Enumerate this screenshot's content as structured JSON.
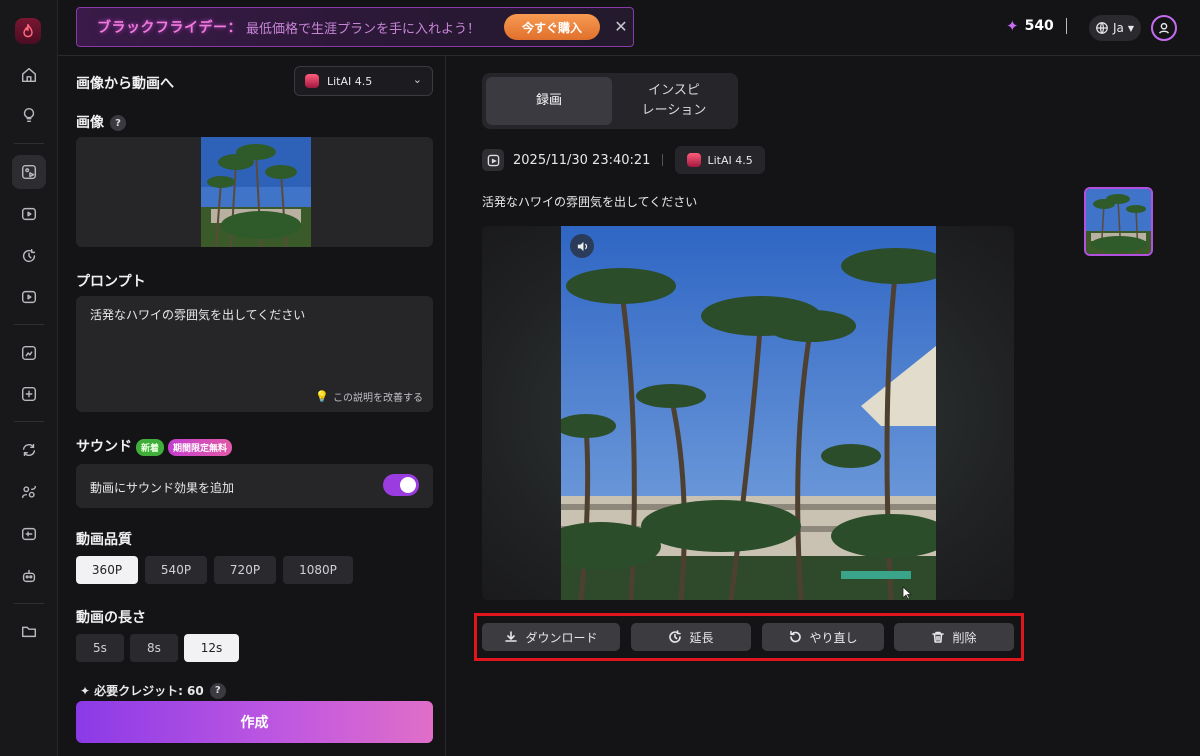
{
  "app": {
    "accent": "#9a3ce0",
    "logo": "flame-logo-icon"
  },
  "rail": {
    "icons": [
      "home-icon",
      "bulb-icon",
      "image-to-video-icon",
      "text-to-video-icon",
      "extend-icon",
      "video-icon",
      "image-edit-icon",
      "image-add-icon",
      "swap-icon",
      "people-icon",
      "lip-sync-icon",
      "robot-icon",
      "folder-icon"
    ]
  },
  "promo": {
    "title": "ブラックフライデー：",
    "message": "最低価格で生涯プランを手に入れよう！",
    "button": "今すぐ購入",
    "close": "✕"
  },
  "header": {
    "credits": "540",
    "language": "Ja"
  },
  "panel": {
    "title": "画像から動画へ",
    "model": "LitAI 4.5",
    "image_label": "画像",
    "help": "?",
    "prompt_label": "プロンプト",
    "prompt_text": "活発なハワイの雰囲気を出してください",
    "improve": "この説明を改善する",
    "sound_label": "サウンド",
    "badge_new": "新着",
    "badge_limited": "期間限定無料",
    "sound_option": "動画にサウンド効果を追加",
    "sound_enabled": true,
    "quality_label": "動画品質",
    "qualities": [
      "360P",
      "540P",
      "720P",
      "1080P"
    ],
    "quality_selected": "360P",
    "length_label": "動画の長さ",
    "lengths": [
      "5s",
      "8s",
      "12s"
    ],
    "length_selected": "12s",
    "credit_need": "必要クレジット: 60",
    "create": "作成"
  },
  "result": {
    "tab_record": "録画",
    "tab_inspire_1": "インスピ",
    "tab_inspire_2": "レーション",
    "timestamp": "2025/11/30 23:40:21",
    "model": "LitAI 4.5",
    "description": "活発なハワイの雰囲気を出してください",
    "actions": {
      "download": "ダウンロード",
      "extend": "延長",
      "redo": "やり直し",
      "delete": "削除"
    }
  }
}
